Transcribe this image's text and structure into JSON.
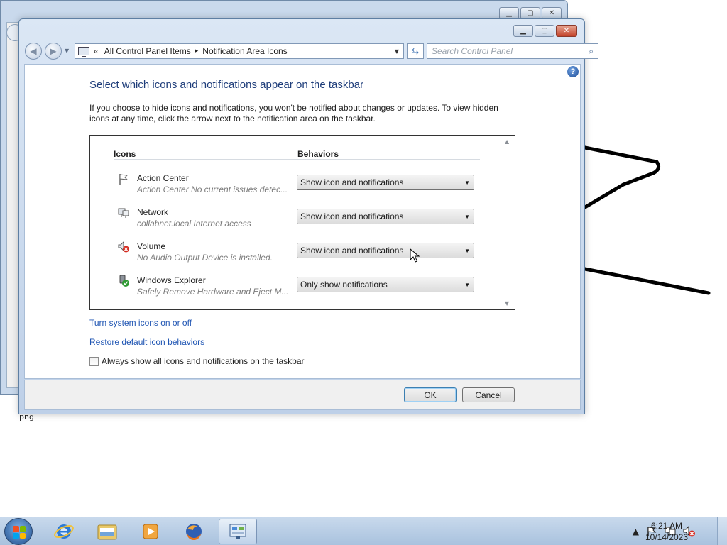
{
  "desktop": {
    "file_label": "png"
  },
  "dialog": {
    "address": {
      "overflow_glyph": "«",
      "crumbs": [
        "All Control Panel Items",
        "Notification Area Icons"
      ],
      "separator": "▸"
    },
    "search": {
      "placeholder": "Search Control Panel"
    },
    "help_label": "?",
    "title": "Select which icons and notifications appear on the taskbar",
    "description": "If you choose to hide icons and notifications, you won't be notified about changes or updates. To view hidden icons at any time, click the arrow next to the notification area on the taskbar.",
    "table": {
      "col_icons": "Icons",
      "col_behaviors": "Behaviors",
      "rows": [
        {
          "name": "Action Center",
          "desc": "Action Center  No current issues detec...",
          "behavior": "Show icon and notifications",
          "icon": "flag-icon"
        },
        {
          "name": "Network",
          "desc": "collabnet.local Internet access",
          "behavior": "Show icon and notifications",
          "icon": "network-icon"
        },
        {
          "name": "Volume",
          "desc": "No Audio Output Device is installed.",
          "behavior": "Show icon and notifications",
          "icon": "volume-muted-icon"
        },
        {
          "name": "Windows Explorer",
          "desc": "Safely Remove Hardware and Eject M...",
          "behavior": "Only show notifications",
          "icon": "safely-remove-hardware-icon"
        }
      ]
    },
    "links": {
      "system_icons": "Turn system icons on or off",
      "restore": "Restore default icon behaviors"
    },
    "checkbox": {
      "label": "Always show all icons and notifications on the taskbar",
      "checked": false
    },
    "buttons": {
      "ok": "OK",
      "cancel": "Cancel"
    }
  },
  "taskbar": {
    "pinned": [
      "internet-explorer-icon",
      "windows-explorer-icon",
      "media-player-icon",
      "firefox-icon",
      "control-panel-icon"
    ],
    "active": "control-panel-icon",
    "clock": {
      "time": "6:21 AM",
      "date": "10/14/2023"
    }
  },
  "colors": {
    "title_blue": "#1e3d7a",
    "link_blue": "#1f55b3",
    "close_red": "#c3442b"
  }
}
